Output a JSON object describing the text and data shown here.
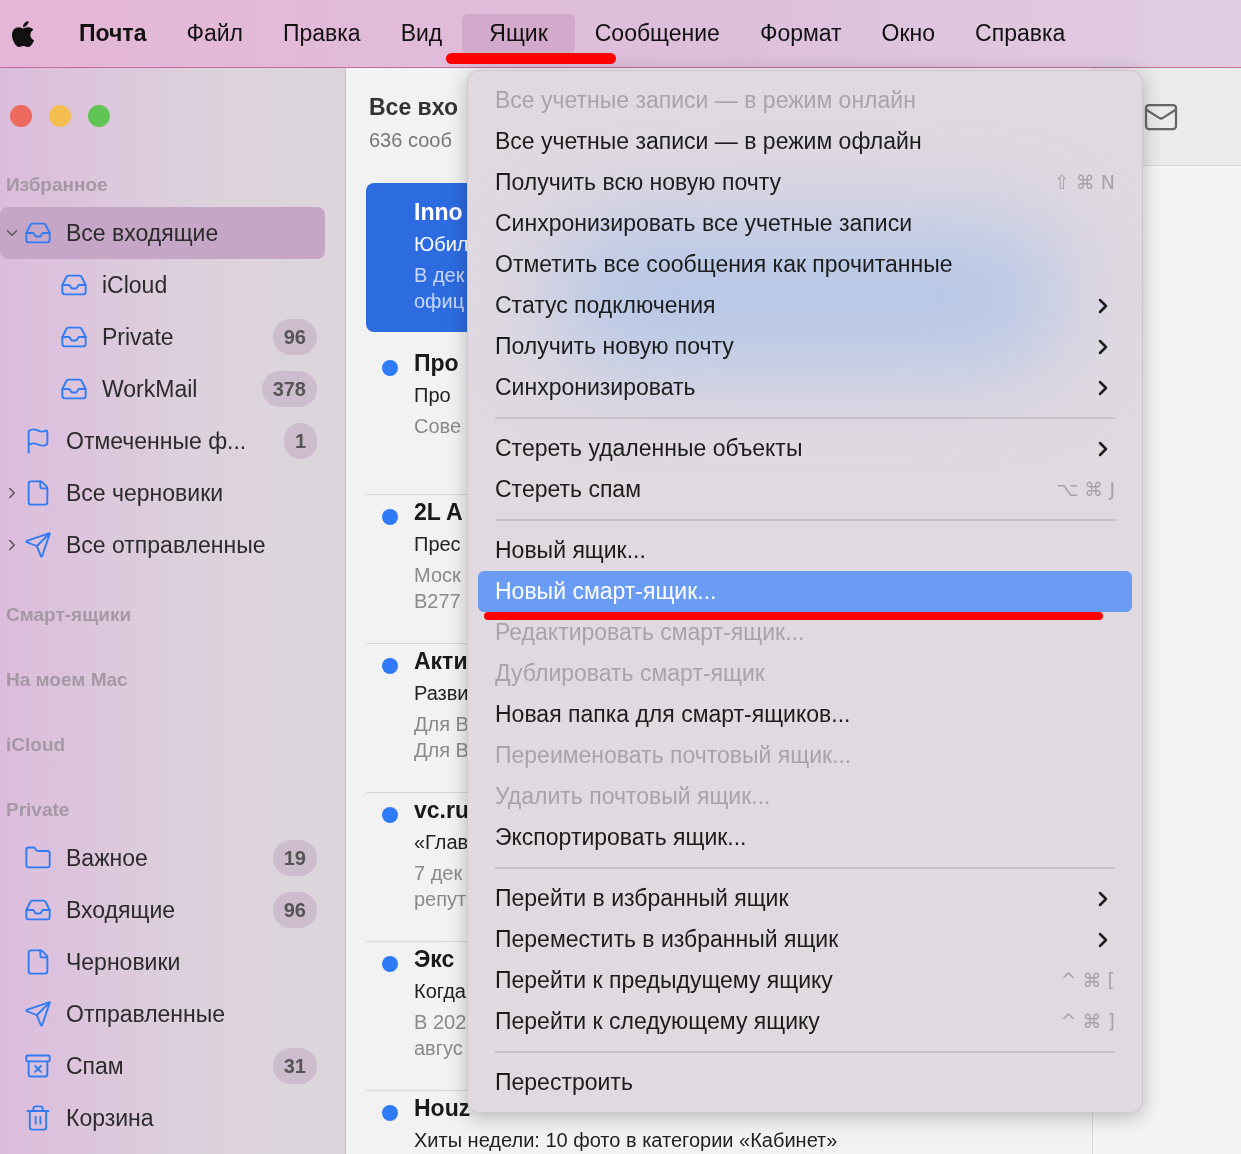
{
  "menu_bar": {
    "items": [
      {
        "label": "Почта",
        "kind": "app",
        "selected": false
      },
      {
        "label": "Файл",
        "kind": "menu",
        "selected": false
      },
      {
        "label": "Правка",
        "kind": "menu",
        "selected": false
      },
      {
        "label": "Вид",
        "kind": "menu",
        "selected": false
      },
      {
        "label": "Ящик",
        "kind": "menu",
        "selected": true
      },
      {
        "label": "Сообщение",
        "kind": "menu",
        "selected": false
      },
      {
        "label": "Формат",
        "kind": "menu",
        "selected": false
      },
      {
        "label": "Окно",
        "kind": "menu",
        "selected": false
      },
      {
        "label": "Справка",
        "kind": "menu",
        "selected": false
      }
    ]
  },
  "sidebar": {
    "sections": [
      {
        "title": "Избранное",
        "items": [
          {
            "label": "Все входящие",
            "kind": "all_inboxes",
            "selected": true,
            "expanded": true,
            "children": [
              {
                "label": "iCloud",
                "kind": "inbox",
                "selected": false
              },
              {
                "label": "Private",
                "kind": "inbox",
                "selected": false,
                "count": "96"
              },
              {
                "label": "WorkMail",
                "kind": "inbox",
                "selected": false,
                "count": "378"
              }
            ]
          },
          {
            "label": "Отмеченные ф...",
            "kind": "flagged",
            "selected": false,
            "count": "1"
          },
          {
            "label": "Все черновики",
            "kind": "drafts",
            "selected": false,
            "expanded": false
          },
          {
            "label": "Все отправленные",
            "kind": "sent",
            "selected": false,
            "expanded": false
          }
        ]
      },
      {
        "title": "Смарт-ящики"
      },
      {
        "title": "На моем Mac"
      },
      {
        "title": "iCloud"
      },
      {
        "title": "Private",
        "items": [
          {
            "label": "Важное",
            "kind": "folder",
            "selected": false,
            "count": "19"
          },
          {
            "label": "Входящие",
            "kind": "inbox",
            "selected": false,
            "count": "96"
          },
          {
            "label": "Черновики",
            "kind": "drafts",
            "selected": false
          },
          {
            "label": "Отправленные",
            "kind": "sent",
            "selected": false
          },
          {
            "label": "Спам",
            "kind": "spam",
            "selected": false,
            "count": "31"
          },
          {
            "label": "Корзина",
            "kind": "trash",
            "selected": false
          }
        ]
      }
    ]
  },
  "message_list": {
    "title": "Все вхо",
    "subtitle": "636 сооб",
    "messages": [
      {
        "sender": "Inno",
        "subject": "Юбил",
        "preview": [
          "В дек",
          "офиц"
        ],
        "selected": true,
        "unread": false
      },
      {
        "sender": "Про",
        "subject": "Про",
        "preview": [
          "Сове"
        ],
        "selected": false,
        "unread": true
      },
      {
        "sender": "2L A",
        "subject": "Прес",
        "preview": [
          "Моск",
          "B277"
        ],
        "selected": false,
        "unread": true
      },
      {
        "sender": "Акти",
        "subject": "Разви",
        "preview": [
          "Для В",
          "Для В"
        ],
        "selected": false,
        "unread": true
      },
      {
        "sender": "vc.ru",
        "subject": "«Глав",
        "preview": [
          "7 дек",
          "репут"
        ],
        "selected": false,
        "unread": true
      },
      {
        "sender": "Экс",
        "subject": "Когда",
        "preview": [
          "В 202",
          "авгус"
        ],
        "selected": false,
        "unread": true
      },
      {
        "sender": "Houz",
        "subject": "Хиты недели: 10 фото в категории «Кабинет»",
        "selected": false,
        "unread": true
      }
    ]
  },
  "dropdown_menu": {
    "items": [
      {
        "kind": "item",
        "label": "Все учетные записи — в режим онлайн",
        "disabled": true,
        "selected": false
      },
      {
        "kind": "item",
        "label": "Все учетные записи — в режим офлайн",
        "disabled": false,
        "selected": false
      },
      {
        "kind": "item",
        "label": "Получить всю новую почту",
        "disabled": false,
        "selected": false,
        "shortcut": "⇧ ⌘ N"
      },
      {
        "kind": "item",
        "label": "Синхронизировать все учетные записи",
        "disabled": false,
        "selected": false
      },
      {
        "kind": "item",
        "label": "Отметить все сообщения как прочитанные",
        "disabled": false,
        "selected": false
      },
      {
        "kind": "item",
        "label": "Статус подключения",
        "disabled": false,
        "selected": false,
        "submenu": true
      },
      {
        "kind": "item",
        "label": "Получить новую почту",
        "disabled": false,
        "selected": false,
        "submenu": true
      },
      {
        "kind": "item",
        "label": "Синхронизировать",
        "disabled": false,
        "selected": false,
        "submenu": true
      },
      {
        "kind": "separator"
      },
      {
        "kind": "item",
        "label": "Стереть удаленные объекты",
        "disabled": false,
        "selected": false,
        "submenu": true
      },
      {
        "kind": "item",
        "label": "Стереть спам",
        "disabled": false,
        "selected": false,
        "shortcut": "⌥ ⌘ J"
      },
      {
        "kind": "separator"
      },
      {
        "kind": "item",
        "label": "Новый ящик...",
        "disabled": false,
        "selected": false
      },
      {
        "kind": "item",
        "label": "Новый смарт-ящик...",
        "disabled": false,
        "selected": true
      },
      {
        "kind": "item",
        "label": "Редактировать смарт-ящик...",
        "disabled": true,
        "selected": false
      },
      {
        "kind": "item",
        "label": "Дублировать смарт-ящик",
        "disabled": true,
        "selected": false
      },
      {
        "kind": "item",
        "label": "Новая папка для смарт-ящиков...",
        "disabled": false,
        "selected": false
      },
      {
        "kind": "item",
        "label": "Переименовать почтовый ящик...",
        "disabled": true,
        "selected": false
      },
      {
        "kind": "item",
        "label": "Удалить почтовый ящик...",
        "disabled": true,
        "selected": false
      },
      {
        "kind": "item",
        "label": "Экспортировать ящик...",
        "disabled": false,
        "selected": false
      },
      {
        "kind": "separator"
      },
      {
        "kind": "item",
        "label": "Перейти в избранный ящик",
        "disabled": false,
        "selected": false,
        "submenu": true
      },
      {
        "kind": "item",
        "label": "Переместить в избранный ящик",
        "disabled": false,
        "selected": false,
        "submenu": true
      },
      {
        "kind": "item",
        "label": "Перейти к предыдущему ящику",
        "disabled": false,
        "selected": false,
        "shortcut": "^ ⌘ ["
      },
      {
        "kind": "item",
        "label": "Перейти к следующему ящику",
        "disabled": false,
        "selected": false,
        "shortcut": "^ ⌘ ]"
      },
      {
        "kind": "separator"
      },
      {
        "kind": "item",
        "label": "Перестроить",
        "disabled": false,
        "selected": false
      }
    ]
  }
}
